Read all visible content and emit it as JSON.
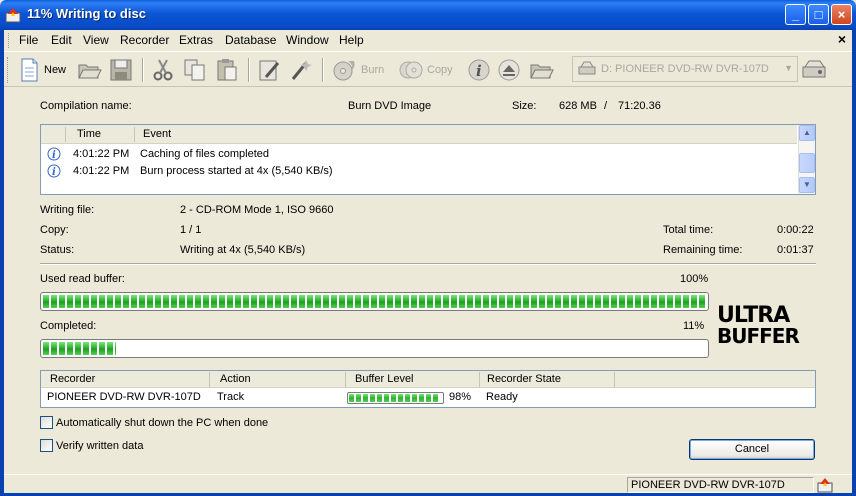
{
  "window": {
    "title": "11% Writing to disc",
    "minimize_glyph": "_",
    "maximize_glyph": "□",
    "close_glyph": "×"
  },
  "menu": {
    "items": [
      "File",
      "Edit",
      "View",
      "Recorder",
      "Extras",
      "Database",
      "Window",
      "Help"
    ],
    "close_glyph": "×"
  },
  "toolbar": {
    "new_label": "New",
    "burn_label": "Burn",
    "copy_label": "Copy",
    "drive_value": "D: PIONEER  DVD-RW  DVR-107D",
    "drive_arrow": "▼",
    "icons": [
      "new-document-icon",
      "open-folder-icon",
      "save-icon",
      "cut-icon",
      "copy-icon",
      "paste-icon",
      "edit-icon",
      "wizard-icon",
      "burn-icon",
      "copy-disc-icon",
      "disc-info-icon",
      "eject-icon",
      "browse-folder-icon",
      "drive-icon",
      "drive-properties-icon"
    ]
  },
  "compilation": {
    "name_label": "Compilation name:",
    "name_value": "Burn DVD Image",
    "size_label": "Size:",
    "size_value": "628 MB",
    "size_sep": "/",
    "duration_value": "71:20.36"
  },
  "events": {
    "columns": [
      "Time",
      "Event"
    ],
    "rows": [
      {
        "time": "4:01:22 PM",
        "event": "Caching of files completed",
        "icon": "info-icon"
      },
      {
        "time": "4:01:22 PM",
        "event": "Burn process started at 4x (5,540 KB/s)",
        "icon": "info-icon"
      }
    ],
    "scroll_up": "▲",
    "scroll_down": "▼"
  },
  "details": {
    "writing_file_label": "Writing file:",
    "writing_file_value": "2 - CD-ROM Mode 1, ISO 9660",
    "copy_label": "Copy:",
    "copy_value": "1 / 1",
    "status_label": "Status:",
    "status_value": "Writing at 4x (5,540 KB/s)",
    "total_time_label": "Total time:",
    "total_time_value": "0:00:22",
    "remaining_time_label": "Remaining time:",
    "remaining_time_value": "0:01:37"
  },
  "buffer": {
    "label": "Used read buffer:",
    "percent_text": "100%",
    "fraction": 1.0
  },
  "completed": {
    "label": "Completed:",
    "percent_text": "11%",
    "fraction": 0.11
  },
  "logo": {
    "line1": "ULTRA",
    "line2": "BUFFER"
  },
  "recorders": {
    "columns": [
      "Recorder",
      "Action",
      "Buffer Level",
      "Recorder State"
    ],
    "rows": [
      {
        "recorder": "PIONEER DVD-RW  DVR-107D",
        "action": "Track",
        "buffer_text": "98%",
        "buffer_fraction": 0.98,
        "state": "Ready"
      }
    ]
  },
  "options": {
    "shutdown_label": "Automatically shut down the PC when done",
    "shutdown_checked": false,
    "verify_label": "Verify written data",
    "verify_checked": false
  },
  "cancel_label": "Cancel",
  "statusbar": {
    "device": "PIONEER  DVD-RW  DVR-107D"
  }
}
